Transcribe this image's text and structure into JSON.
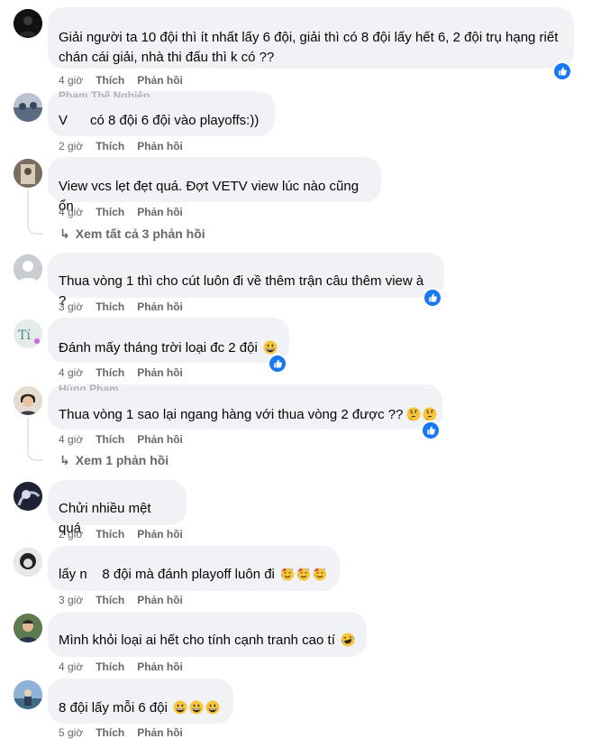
{
  "comments": [
    {
      "author": "",
      "text": "Giải người ta 10 đội thì ít nhất lấy 6 đội, giải thì có 8 đội lấy hết 6, 2 đội trụ hạng riết chán cái giải, nhà thi đấu thì k có ??",
      "time": "4 giờ",
      "like": "Thích",
      "reply": "Phản hồi",
      "has_like_reaction": true
    },
    {
      "author": "Phạm Thế Nghiệp",
      "text": "V      có 8 đội 6 đội vào playoffs:))",
      "time": "2 giờ",
      "like": "Thích",
      "reply": "Phản hồi",
      "has_like_reaction": false
    },
    {
      "author": "",
      "text": "View vcs lẹt đẹt quá. Đợt VETV view lúc nào cũng ổn",
      "time": "4 giờ",
      "like": "Thích",
      "reply": "Phản hồi",
      "has_like_reaction": false,
      "view_replies": "Xem tất cả 3 phản hồi"
    },
    {
      "author": "",
      "text": "Thua vòng 1 thì cho cút luôn đi về thêm trận câu thêm view à ?",
      "time": "3 giờ",
      "like": "Thích",
      "reply": "Phản hồi",
      "has_like_reaction": true
    },
    {
      "author": "",
      "text": "Đánh mấy tháng trời loại đc 2 đội",
      "emoji": "grinning-face",
      "time": "4 giờ",
      "like": "Thích",
      "reply": "Phản hồi",
      "has_like_reaction": true
    },
    {
      "author": "Hùng Phạm",
      "text": "Thua vòng 1 sao lại ngang hàng với thua vòng 2 được ??",
      "emoji": "thinking-face",
      "time": "4 giờ",
      "like": "Thích",
      "reply": "Phản hồi",
      "has_like_reaction": true,
      "view_replies": "Xem 1 phản hồi"
    },
    {
      "author": "",
      "text": "Chửi nhiều mệt quá",
      "time": "2 giờ",
      "like": "Thích",
      "reply": "Phản hồi",
      "has_like_reaction": false
    },
    {
      "author": "",
      "text": "lấy n    8 đội mà đánh playoff luôn đi",
      "emoji": "partying-face",
      "time": "3 giờ",
      "like": "Thích",
      "reply": "Phản hồi",
      "has_like_reaction": false
    },
    {
      "author": "",
      "text": "Mình khỏi loại ai hết cho tính cạnh tranh cao tí",
      "emoji": "rolling-laughing-face",
      "time": "4 giờ",
      "like": "Thích",
      "reply": "Phản hồi",
      "has_like_reaction": false
    },
    {
      "author": "",
      "text": "8 đội lấy mỗi 6 đội",
      "emoji": "grinning-face",
      "time": "5 giờ",
      "like": "Thích",
      "reply": "Phản hồi",
      "has_like_reaction": false
    }
  ],
  "colors": {
    "bubble": "#f0f2f5",
    "meta_text": "#65676b",
    "like_blue": "#1877f2"
  }
}
